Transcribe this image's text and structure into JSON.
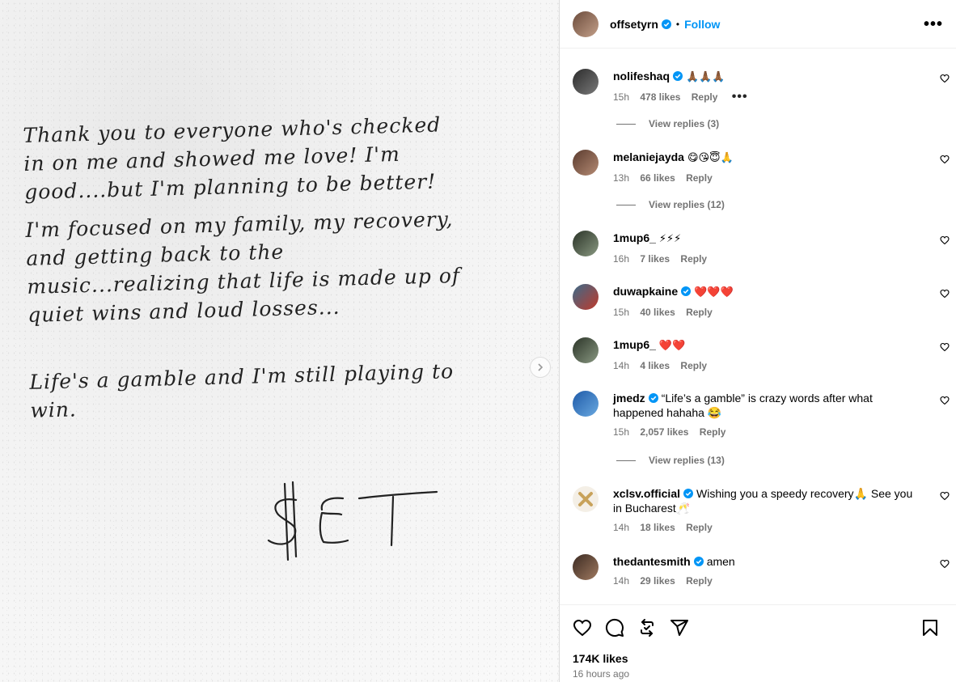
{
  "post": {
    "note_paragraphs": [
      "Thank you to everyone who's checked in on me and showed me love! I'm good....but I'm planning to be better!",
      "I'm focused on my family, my recovery, and getting back to the music...realizing that life is made up of quiet wins and loud losses...",
      "Life's a gamble and I'm still playing to win."
    ],
    "signature": "$ET"
  },
  "header": {
    "username": "offsetyrn",
    "separator": "•",
    "follow_label": "Follow",
    "more_label": "•••"
  },
  "comments": [
    {
      "user": "nolifeshaq",
      "verified": true,
      "text": "🙏🏾🙏🏾🙏🏾",
      "time": "15h",
      "likes": "478 likes",
      "reply": "Reply",
      "more": "•••",
      "view_replies": "View replies (3)"
    },
    {
      "user": "melaniejayda",
      "verified": false,
      "text": "😋😘😇🙏",
      "time": "13h",
      "likes": "66 likes",
      "reply": "Reply",
      "view_replies": "View replies (12)"
    },
    {
      "user": "1mup6_",
      "verified": false,
      "text": "⚡⚡⚡",
      "time": "16h",
      "likes": "7 likes",
      "reply": "Reply"
    },
    {
      "user": "duwapkaine",
      "verified": true,
      "text": "❤️❤️❤️",
      "time": "15h",
      "likes": "40 likes",
      "reply": "Reply"
    },
    {
      "user": "1mup6_",
      "verified": false,
      "text": "❤️❤️",
      "time": "14h",
      "likes": "4 likes",
      "reply": "Reply"
    },
    {
      "user": "jmedz",
      "verified": true,
      "text": "“Life’s a gamble” is crazy words after what happened hahaha 😂",
      "time": "15h",
      "likes": "2,057 likes",
      "reply": "Reply",
      "view_replies": "View replies (13)"
    },
    {
      "user": "xclsv.official",
      "verified": true,
      "text": "Wishing you a speedy recovery🙏 See you in Bucharest🥂",
      "time": "14h",
      "likes": "18 likes",
      "reply": "Reply"
    },
    {
      "user": "thedantesmith",
      "verified": true,
      "text": "amen",
      "time": "14h",
      "likes": "29 likes",
      "reply": "Reply"
    }
  ],
  "footer": {
    "likes": "174K likes",
    "time_ago": "16 hours ago"
  },
  "icons": {
    "like": "heart-icon",
    "comment": "comment-icon",
    "repost": "repost-icon",
    "share": "share-icon",
    "save": "bookmark-icon",
    "verified": "verified-badge-icon",
    "next": "chevron-right-icon"
  },
  "colors": {
    "accent": "#0095f6",
    "verified": "#0095f6",
    "muted": "#737373"
  }
}
